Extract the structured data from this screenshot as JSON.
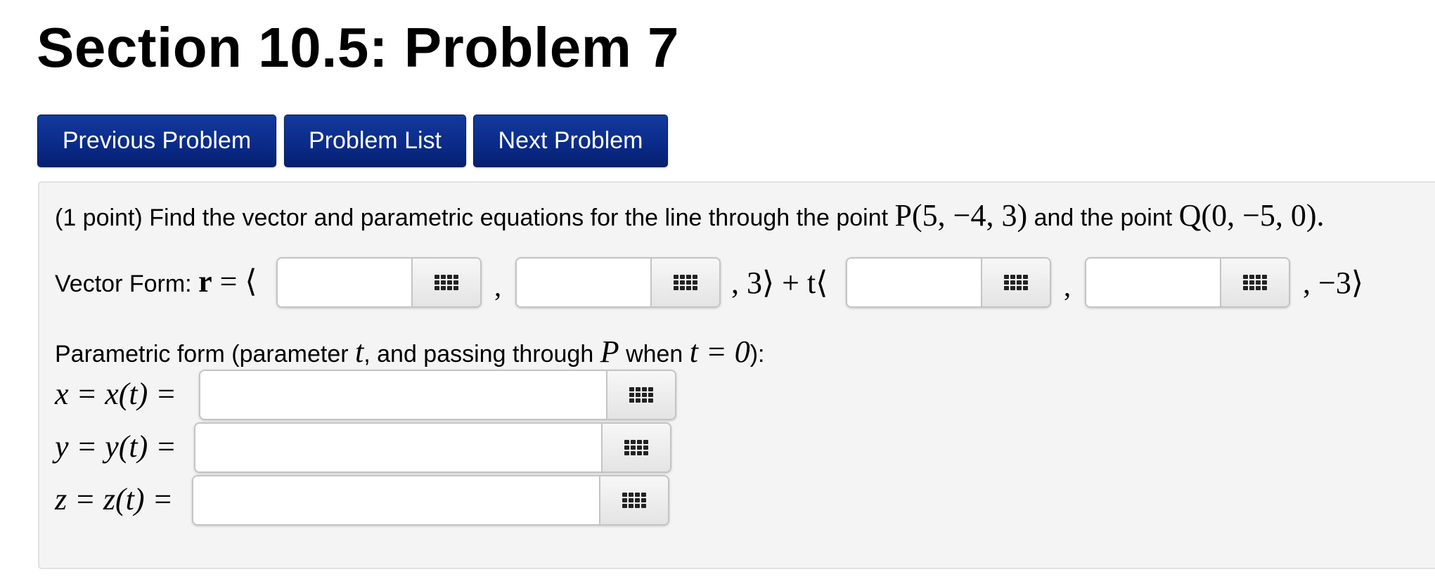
{
  "page": {
    "title": "Section 10.5: Problem 7"
  },
  "nav": {
    "previous_label": "Previous Problem",
    "list_label": "Problem List",
    "next_label": "Next Problem"
  },
  "problem": {
    "points": "(1 point)",
    "statement_part1": "Find the vector and parametric equations for the line through the point",
    "point_p": "P(5, −4, 3)",
    "statement_part2": "and the point",
    "point_q": "Q(0, −5, 0).",
    "vector_form": {
      "label": "Vector Form:",
      "r_symbol": "r",
      "equals_open": "= ⟨",
      "comma": ",",
      "mid_text": ", 3⟩ + t⟨",
      "tail_text": ", −3⟩",
      "answers": [
        "",
        "",
        "",
        ""
      ]
    },
    "parametric": {
      "intro_part1": "Parametric form (parameter",
      "t_var": "t",
      "intro_part2": ", and passing through",
      "p_var": "P",
      "intro_part3": "when",
      "t_eq": "t = 0",
      "intro_part4": "):",
      "x_label": "x = x(t) =",
      "y_label": "y = y(t) =",
      "z_label": "z = z(t) =",
      "x_answer": "",
      "y_answer": "",
      "z_answer": ""
    }
  },
  "icons": {
    "equation_editor": "equation-editor-grid-icon"
  },
  "colors": {
    "nav_button_bg": "#0a2a88",
    "nav_button_text": "#ffffff",
    "problem_bg": "#f4f4f4"
  }
}
